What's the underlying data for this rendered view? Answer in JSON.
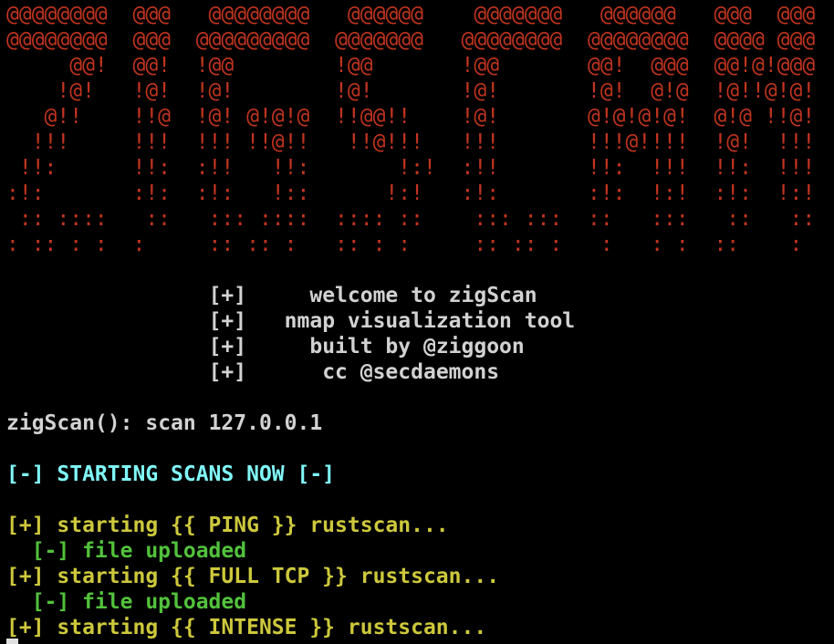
{
  "colors": {
    "art": "#c0341f",
    "text": "#d2d2d2",
    "status": "#80f8f8",
    "progress": "#cdc83c",
    "success": "#52c23c"
  },
  "ascii_art": [
    "@@@@@@@@  @@@   @@@@@@@@   @@@@@@    @@@@@@@   @@@@@@   @@@  @@@",
    "@@@@@@@@  @@@  @@@@@@@@@  @@@@@@@   @@@@@@@@  @@@@@@@@  @@@@ @@@",
    "     @@!  @@!  !@@        !@@       !@@       @@!  @@@  @@!@!@@@",
    "    !@!   !@!  !@!        !@!       !@!       !@!  @!@  !@!!@!@!",
    "   @!!    !!@  !@! @!@!@  !!@@!!    !@!       @!@!@!@!  @!@ !!@!",
    "  !!!     !!!  !!! !!@!!   !!@!!!   !!!       !!!@!!!!  !@!  !!!",
    " !!:      !!:  :!!   !!:       !:!  :!!       !!:  !!!  !!:  !!!",
    ":!:       :!:  :!:   !::      !:!   :!:       :!:  !:!  :!:  !:!",
    " :: ::::   ::   ::: ::::  :::: ::    ::: :::  ::   :::   ::   ::",
    ": :: : :  :     :: :: :   :: : :     :: :: :   :   : :  ::    : "
  ],
  "banner": [
    {
      "bullet": "[+]",
      "text": "     welcome to zigScan"
    },
    {
      "bullet": "[+]",
      "text": "   nmap visualization tool"
    },
    {
      "bullet": "[+]",
      "text": "     built by @ziggoon"
    },
    {
      "bullet": "[+]",
      "text": "      cc @secdaemons"
    }
  ],
  "prompt": {
    "label": "zigScan():",
    "command": "scan 127.0.0.1"
  },
  "status": "[-] STARTING SCANS NOW [-]",
  "log": [
    {
      "type": "progress",
      "text": "[+] starting {{ PING }} rustscan..."
    },
    {
      "type": "success",
      "text": "  [-] file uploaded"
    },
    {
      "type": "progress",
      "text": "[+] starting {{ FULL TCP }} rustscan..."
    },
    {
      "type": "success",
      "text": "  [-] file uploaded"
    },
    {
      "type": "progress",
      "text": "[+] starting {{ INTENSE }} rustscan..."
    }
  ]
}
